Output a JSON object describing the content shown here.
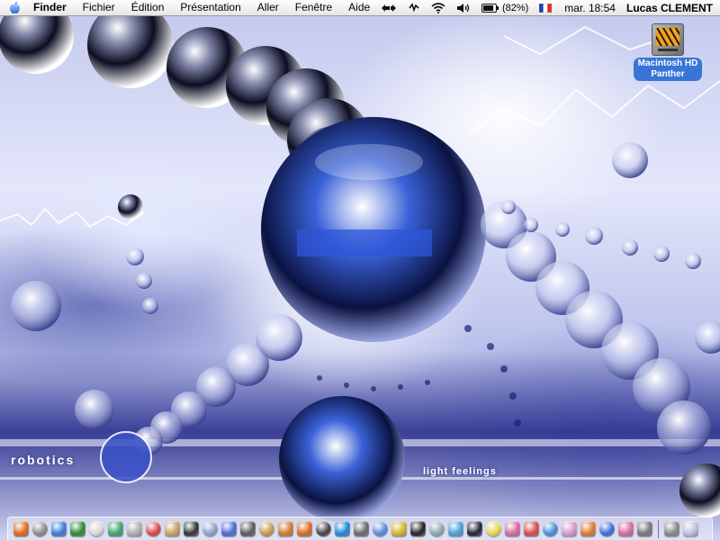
{
  "menubar": {
    "apple_icon": "apple-icon",
    "app_name": "Finder",
    "menus": [
      "Fichier",
      "Édition",
      "Présentation",
      "Aller",
      "Fenêtre",
      "Aide"
    ],
    "extras": {
      "sync_icon": "sync-arrows-icon",
      "vpn_icon": "vpn-icon",
      "airport_icon": "wifi-icon",
      "volume_icon": "volume-icon",
      "battery_icon": "battery-icon",
      "battery_percent": "(82%)",
      "input_flag_icon": "french-flag-icon"
    },
    "clock": "mar. 18:54",
    "user": "Lucas CLEMENT"
  },
  "desktop": {
    "hd_icon": {
      "line1": "Macintosh HD",
      "line2": "Panther"
    },
    "wallpaper_text": {
      "title": "robotics",
      "subtitle": "light feelings"
    }
  },
  "dock": {
    "items": [
      {
        "name": "finder",
        "color": "#e06a1a"
      },
      {
        "name": "system-prefs",
        "color": "#8a8a8a"
      },
      {
        "name": "safari",
        "color": "#3b7ad8"
      },
      {
        "name": "mail",
        "color": "#2f8a2f"
      },
      {
        "name": "ichat",
        "color": "#d8d8d8"
      },
      {
        "name": "itunes",
        "color": "#3aa56a"
      },
      {
        "name": "iphoto",
        "color": "#b0b0b0"
      },
      {
        "name": "ical",
        "color": "#d44"
      },
      {
        "name": "address-book",
        "color": "#c8a060"
      },
      {
        "name": "terminal",
        "color": "#333"
      },
      {
        "name": "preview",
        "color": "#8aa0c8"
      },
      {
        "name": "quicktime",
        "color": "#4a6ad8"
      },
      {
        "name": "network",
        "color": "#5a5a5a"
      },
      {
        "name": "photoshop",
        "color": "#c89a4a"
      },
      {
        "name": "illustrator",
        "color": "#d27a2a"
      },
      {
        "name": "firefox",
        "color": "#e06a1a"
      },
      {
        "name": "camino",
        "color": "#444"
      },
      {
        "name": "skype",
        "color": "#1a8ad8"
      },
      {
        "name": "utility",
        "color": "#6a6a6a"
      },
      {
        "name": "imovie",
        "color": "#5a8ad8"
      },
      {
        "name": "garageband",
        "color": "#d8b22a"
      },
      {
        "name": "x11",
        "color": "#222"
      },
      {
        "name": "disk-utility",
        "color": "#8aa"
      },
      {
        "name": "monitor",
        "color": "#4aa0d8"
      },
      {
        "name": "console",
        "color": "#223"
      },
      {
        "name": "stickies",
        "color": "#e8d84a"
      },
      {
        "name": "app-k",
        "color": "#d86aa0"
      },
      {
        "name": "app-p",
        "color": "#d84a4a"
      },
      {
        "name": "app-u",
        "color": "#4a8ad8"
      },
      {
        "name": "app-cat",
        "color": "#d89ac8"
      },
      {
        "name": "app-fire",
        "color": "#e07a2a"
      },
      {
        "name": "app-blue",
        "color": "#3a6ad8"
      },
      {
        "name": "app-pink",
        "color": "#d86a9a"
      },
      {
        "name": "app-gray",
        "color": "#777"
      }
    ],
    "right_items": [
      {
        "name": "downloads",
        "color": "#888"
      },
      {
        "name": "trash",
        "color": "#b8c4d8"
      }
    ]
  }
}
